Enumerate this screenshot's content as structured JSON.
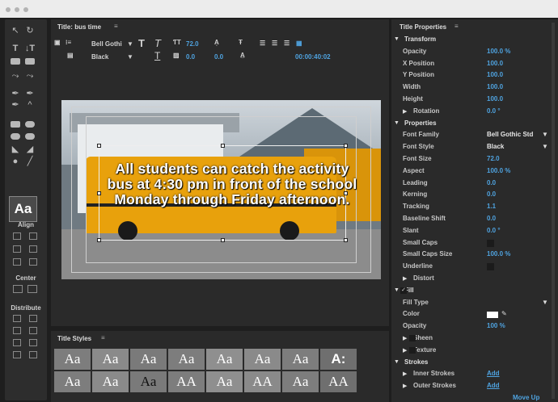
{
  "window": {
    "dots": [
      "#b3b3b3",
      "#b3b3b3",
      "#b3b3b3"
    ]
  },
  "tools": {
    "aa_label": "Aa",
    "align_label": "Align",
    "center_label": "Center",
    "distribute_label": "Distribute"
  },
  "title_panel": {
    "title": "Title: bus time",
    "font_family": "Bell Gothi",
    "font_style": "Black",
    "font_size": "72.0",
    "kerning": "0.0",
    "leading": "0.0",
    "timecode": "00:00:40:02",
    "caption": "All students can catch the activity bus at 4:30 pm in front of the school Monday through Friday afternoon."
  },
  "styles": {
    "title": "Title Styles",
    "row1": [
      "Aa",
      "Aa",
      "Aa",
      "Aa",
      "Aa",
      "Aa",
      "Aa",
      "A:"
    ],
    "row2": [
      "Aa",
      "Aa",
      "Aa",
      "AA",
      "Aa",
      "AA",
      "Aa",
      "AA"
    ]
  },
  "props": {
    "title": "Title Properties",
    "rows": [
      {
        "kind": "sect",
        "label": "Transform"
      },
      {
        "kind": "val",
        "label": "Opacity",
        "value": "100.0 %"
      },
      {
        "kind": "val",
        "label": "X Position",
        "value": "100.0"
      },
      {
        "kind": "val",
        "label": "Y Position",
        "value": "100.0"
      },
      {
        "kind": "val",
        "label": "Width",
        "value": "100.0"
      },
      {
        "kind": "val",
        "label": "Height",
        "value": "100.0"
      },
      {
        "kind": "sub",
        "label": "Rotation",
        "value": "0.0 °"
      },
      {
        "kind": "sect",
        "label": "Properties"
      },
      {
        "kind": "val",
        "label": "Font Family",
        "value": "Bell Gothic Std"
      },
      {
        "kind": "val",
        "label": "Font Style",
        "value": "Black"
      },
      {
        "kind": "val",
        "label": "Font Size",
        "value": "72.0"
      },
      {
        "kind": "val",
        "label": "Aspect",
        "value": "100.0 %"
      },
      {
        "kind": "val",
        "label": "Leading",
        "value": "0.0"
      },
      {
        "kind": "val",
        "label": "Kerning",
        "value": "0.0"
      },
      {
        "kind": "val",
        "label": "Tracking",
        "value": "1.1"
      },
      {
        "kind": "val",
        "label": "Baseline Shift",
        "value": "0.0"
      },
      {
        "kind": "val",
        "label": "Slant",
        "value": "0.0 °"
      },
      {
        "kind": "chk",
        "label": "Small Caps"
      },
      {
        "kind": "val",
        "label": "Small Caps Size",
        "value": "100.0 %"
      },
      {
        "kind": "chk",
        "label": "Underline"
      },
      {
        "kind": "sub",
        "label": "Distort",
        "value": ""
      },
      {
        "kind": "sect",
        "label": "Fill"
      },
      {
        "kind": "val",
        "label": "Fill Type",
        "value": ""
      },
      {
        "kind": "val",
        "label": "Color",
        "value": ""
      },
      {
        "kind": "val",
        "label": "Opacity",
        "value": "100 %"
      },
      {
        "kind": "sub",
        "label": "Sheen",
        "value": ""
      },
      {
        "kind": "sub",
        "label": "Texture",
        "value": ""
      },
      {
        "kind": "sect",
        "label": "Strokes"
      },
      {
        "kind": "sub",
        "label": "Inner Strokes",
        "value": "Add"
      },
      {
        "kind": "sub",
        "label": "Outer Strokes",
        "value": "Add"
      },
      {
        "kind": "val",
        "label": "",
        "value": "Move Up"
      }
    ]
  }
}
